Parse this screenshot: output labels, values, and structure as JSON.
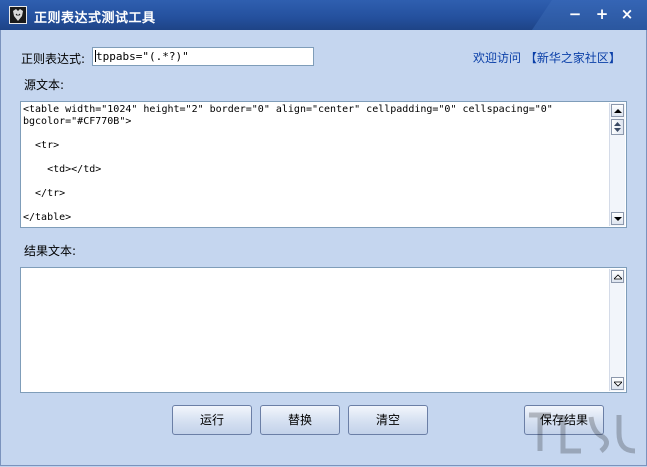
{
  "window": {
    "title": "正则表达式测试工具",
    "controls": {
      "minimize": "−",
      "maximize": "+",
      "close": "×"
    }
  },
  "regex": {
    "label": "正则表达式:",
    "value": "tppabs=\"(.*?)\""
  },
  "visit": {
    "prefix": "欢迎访问",
    "link": "【新华之家社区】"
  },
  "source": {
    "label": "源文本:",
    "text": "<table width=\"1024\" height=\"2\" border=\"0\" align=\"center\" cellpadding=\"0\" cellspacing=\"0\"\nbgcolor=\"#CF770B\">\n\n  <tr>\n\n    <td></td>\n\n  </tr>\n\n</table>"
  },
  "result": {
    "label": "结果文本:",
    "text": ""
  },
  "buttons": {
    "run": "运行",
    "replace": "替换",
    "clear": "清空",
    "save": "保存结果"
  },
  "colors": {
    "titlebar": "#24509d",
    "background": "#c5d6ef",
    "link": "#0a3fa8"
  }
}
